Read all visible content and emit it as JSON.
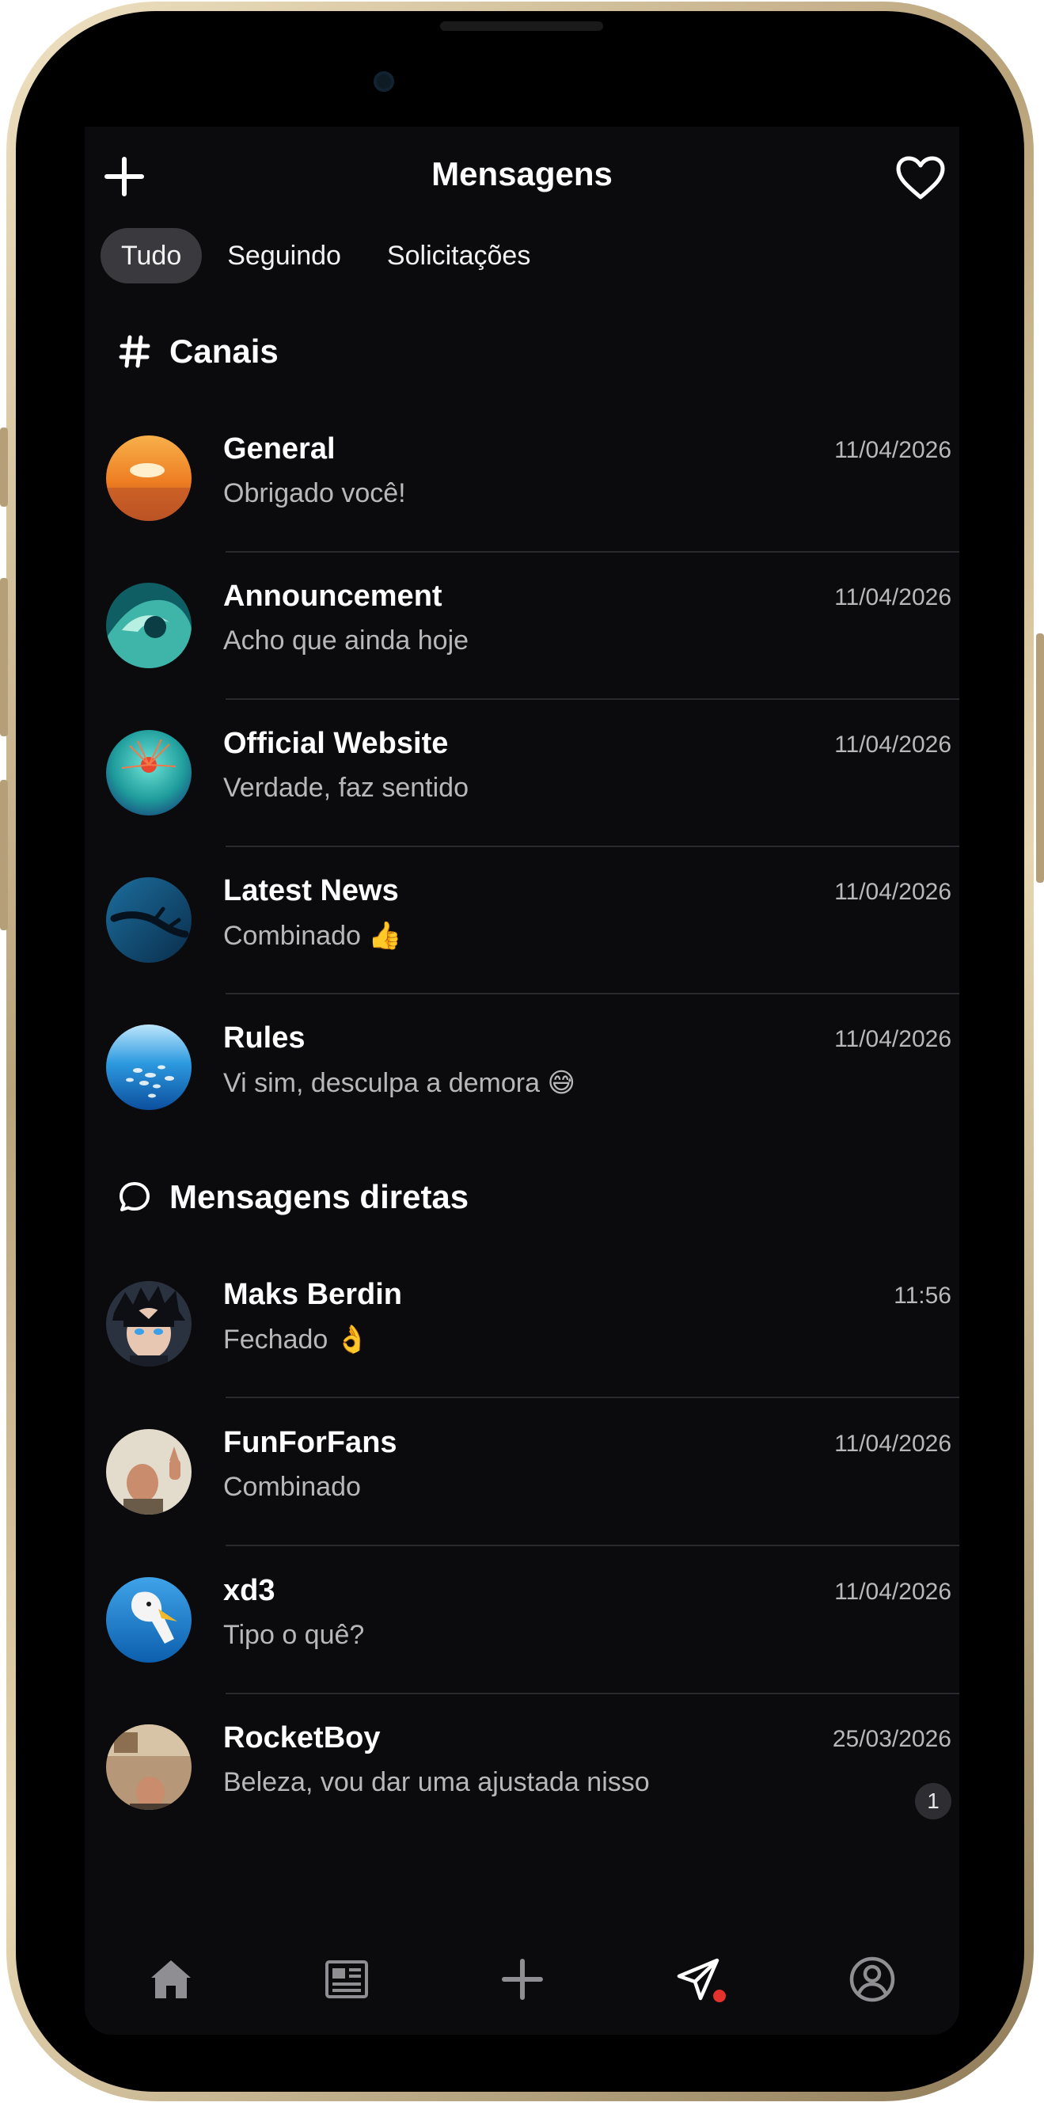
{
  "header": {
    "title": "Mensagens"
  },
  "tabs": [
    {
      "label": "Tudo",
      "active": true
    },
    {
      "label": "Seguindo",
      "active": false
    },
    {
      "label": "Solicitações",
      "active": false
    }
  ],
  "sections": {
    "channels": {
      "title": "Canais",
      "items": [
        {
          "name": "General",
          "message": "Obrigado você!",
          "time": "11/04/2026"
        },
        {
          "name": "Announcement",
          "message": "Acho que ainda hoje",
          "time": "11/04/2026"
        },
        {
          "name": "Official Website",
          "message": "Verdade, faz sentido",
          "time": "11/04/2026"
        },
        {
          "name": "Latest News",
          "message": "Combinado 👍",
          "time": "11/04/2026"
        },
        {
          "name": "Rules",
          "message": "Vi sim, desculpa a demora 😅",
          "time": "11/04/2026"
        }
      ]
    },
    "direct": {
      "title": "Mensagens diretas",
      "items": [
        {
          "name": "Maks Berdin",
          "message": "Fechado 👌",
          "time": "11:56"
        },
        {
          "name": "FunForFans",
          "message": "Combinado",
          "time": "11/04/2026"
        },
        {
          "name": "xd3",
          "message": "Tipo o quê?",
          "time": "11/04/2026"
        },
        {
          "name": "RocketBoy",
          "message": "Beleza, vou dar uma ajustada nisso",
          "time": "25/03/2026",
          "unread": "1"
        }
      ]
    }
  },
  "icons": {
    "new_message": "plus-icon",
    "favorites": "heart-icon",
    "channels": "hash-icon",
    "direct": "chat-bubble-icon",
    "nav": [
      "home-icon",
      "news-icon",
      "plus-icon",
      "send-icon",
      "profile-icon"
    ]
  },
  "colors": {
    "background": "#0b0b0d",
    "active_tab": "#3a3a3e",
    "notification_dot": "#e5322d",
    "secondary_text": "#b8b8bc"
  }
}
